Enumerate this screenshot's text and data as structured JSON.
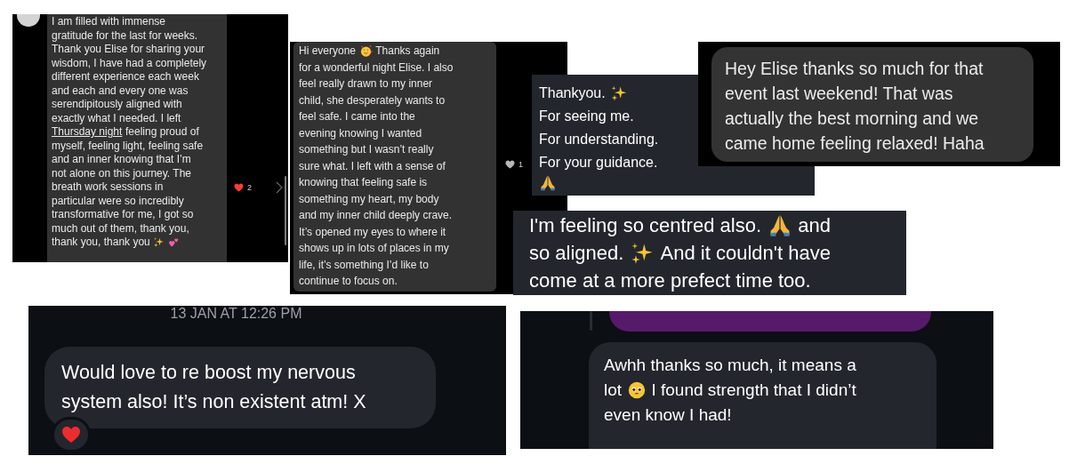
{
  "screenshots": [
    {
      "kind": "comment",
      "likes": "2",
      "liked": true,
      "lines": [
        [
          {
            "kind": "text",
            "text": "I am filled with immense"
          }
        ],
        [
          {
            "kind": "text",
            "text": "gratitude for the last for weeks."
          }
        ],
        [
          {
            "kind": "text",
            "text": "Thank you Elise for sharing your"
          }
        ],
        [
          {
            "kind": "text",
            "text": "wisdom, I have had a completely"
          }
        ],
        [
          {
            "kind": "text",
            "text": "different experience each week"
          }
        ],
        [
          {
            "kind": "text",
            "text": "and each and every one was"
          }
        ],
        [
          {
            "kind": "text",
            "text": "serendipitously aligned with"
          }
        ],
        [
          {
            "kind": "text",
            "text": "exactly what I needed. I left"
          }
        ],
        [
          {
            "kind": "link",
            "text": "Thursday night"
          },
          {
            "kind": "text",
            "text": " feeling proud of"
          }
        ],
        [
          {
            "kind": "text",
            "text": "myself, feeling light, feeling safe"
          }
        ],
        [
          {
            "kind": "text",
            "text": "and an inner knowing that I’m"
          }
        ],
        [
          {
            "kind": "text",
            "text": "not alone on this journey. The"
          }
        ],
        [
          {
            "kind": "text",
            "text": "breath work sessions in"
          }
        ],
        [
          {
            "kind": "text",
            "text": "particular were so incredibly"
          }
        ],
        [
          {
            "kind": "text",
            "text": "transformative for me, I got so"
          }
        ],
        [
          {
            "kind": "text",
            "text": "much out of them, thank you,"
          }
        ],
        [
          {
            "kind": "text",
            "text": "thank you, thank you"
          },
          {
            "kind": "sparkles"
          },
          {
            "kind": "two-hearts"
          }
        ]
      ]
    },
    {
      "kind": "comment",
      "likes": "1",
      "liked": false,
      "lines": [
        [
          {
            "kind": "text",
            "text": "Hi everyone"
          },
          {
            "kind": "hearts-face"
          },
          {
            "kind": "text",
            "text": "Thanks again"
          }
        ],
        [
          {
            "kind": "text",
            "text": "for a wonderful night Elise. I also"
          }
        ],
        [
          {
            "kind": "text",
            "text": "feel really drawn to my inner"
          }
        ],
        [
          {
            "kind": "text",
            "text": "child, she desperately wants to"
          }
        ],
        [
          {
            "kind": "text",
            "text": "feel safe. I came into the"
          }
        ],
        [
          {
            "kind": "text",
            "text": "evening knowing I wanted"
          }
        ],
        [
          {
            "kind": "text",
            "text": "something but I wasn’t really"
          }
        ],
        [
          {
            "kind": "text",
            "text": "sure what. I left with a sense of"
          }
        ],
        [
          {
            "kind": "text",
            "text": "knowing that feeling safe is"
          }
        ],
        [
          {
            "kind": "text",
            "text": "something my heart, my body"
          }
        ],
        [
          {
            "kind": "text",
            "text": "and my inner child deeply crave."
          }
        ],
        [
          {
            "kind": "text",
            "text": "It’s opened my eyes to where it"
          }
        ],
        [
          {
            "kind": "text",
            "text": "shows up in lots of places in my"
          }
        ],
        [
          {
            "kind": "text",
            "text": "life, it’s something I’d like to"
          }
        ],
        [
          {
            "kind": "text",
            "text": "continue to focus on."
          }
        ]
      ]
    },
    {
      "kind": "note",
      "lines": [
        [
          {
            "kind": "text",
            "text": "Thankyou."
          },
          {
            "kind": "sparkles"
          }
        ],
        [
          {
            "kind": "text",
            "text": "For seeing me."
          }
        ],
        [
          {
            "kind": "text",
            "text": "For understanding."
          }
        ],
        [
          {
            "kind": "text",
            "text": "For your guidance."
          }
        ],
        [
          {
            "kind": "pray"
          }
        ]
      ]
    },
    {
      "kind": "imessage",
      "lines": [
        [
          {
            "kind": "text",
            "text": "Hey Elise thanks so much for that"
          }
        ],
        [
          {
            "kind": "text",
            "text": "event last weekend! That was"
          }
        ],
        [
          {
            "kind": "text",
            "text": "actually the best morning and we"
          }
        ],
        [
          {
            "kind": "text",
            "text": "came home feeling relaxed! Haha"
          }
        ]
      ]
    },
    {
      "kind": "note",
      "lines": [
        [
          {
            "kind": "text",
            "text": "I'm feeling so centred also."
          },
          {
            "kind": "pray"
          },
          {
            "kind": "text",
            "text": "and"
          }
        ],
        [
          {
            "kind": "text",
            "text": "so aligned."
          },
          {
            "kind": "sparkles"
          },
          {
            "kind": "text",
            "text": "And it couldn't have"
          }
        ],
        [
          {
            "kind": "text",
            "text": "come at a more prefect time too."
          }
        ]
      ]
    },
    {
      "kind": "dm",
      "timestamp": "13 JAN AT 12:26 PM",
      "lines": [
        [
          {
            "kind": "text",
            "text": "Would love to re boost my nervous"
          }
        ],
        [
          {
            "kind": "text",
            "text": "system also! It’s non existent atm! X"
          }
        ]
      ]
    },
    {
      "kind": "dm-reply",
      "lines": [
        [
          {
            "kind": "text",
            "text": "Awhh thanks so much, it means a"
          }
        ],
        [
          {
            "kind": "text",
            "text": "lot"
          },
          {
            "kind": "pleading"
          },
          {
            "kind": "text",
            "text": "I found strength that I didn’t"
          }
        ],
        [
          {
            "kind": "text",
            "text": "even know I had!"
          }
        ]
      ]
    }
  ]
}
